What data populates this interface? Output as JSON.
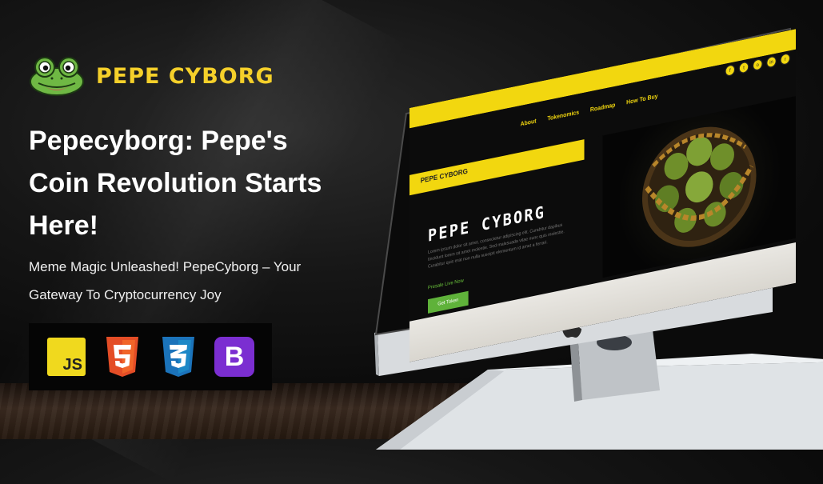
{
  "brand": {
    "name": "PEPE CYBORG",
    "accent": "#f5d02a",
    "frog_green": "#7ec850"
  },
  "hero": {
    "headline": "Pepecyborg: Pepe's Coin Revolution Starts Here!",
    "subheadline": "Meme Magic Unleashed! PepeCyborg – Your Gateway To Cryptocurrency Joy"
  },
  "tech_stack": [
    {
      "name": "JS",
      "icon": "javascript-icon",
      "color": "#f0d91e"
    },
    {
      "name": "HTML5",
      "icon": "html5-icon",
      "color": "#e44d26"
    },
    {
      "name": "CSS3",
      "icon": "css3-icon",
      "color": "#1b73ba"
    },
    {
      "name": "B",
      "icon": "bootstrap-icon",
      "color": "#7b2ed1"
    }
  ],
  "mockup_site": {
    "nav": [
      "About",
      "Tokenomics",
      "Roadmap",
      "How To Buy"
    ],
    "logo_text": "PEPE CYBORG",
    "title": "PEPE CYBORG",
    "body": "Lorem ipsum dolor sit amet, consectetur adipiscing elit. Curabitur dapibus tincidunt lorem sit amet molestie. Sed malesuada vitae nunc quis molestie. Curabitur quis erat non nulla suscipit elementum id amet a ferrari.",
    "presale_label": "Presale Live Now",
    "cta": "Get Token",
    "accent": "#f2d70f",
    "cta_color": "#5fb23a"
  }
}
